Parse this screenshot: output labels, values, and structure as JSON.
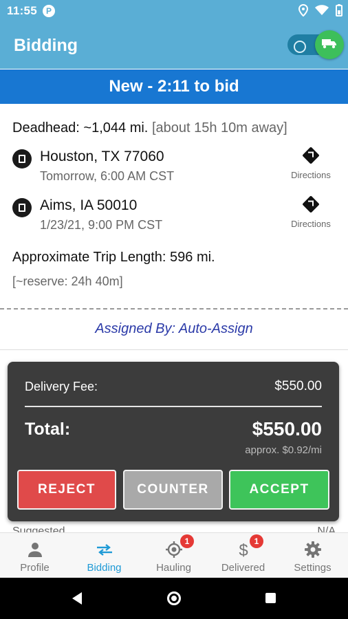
{
  "status_bar": {
    "time": "11:55",
    "app_icon": "P",
    "icons": [
      "location-icon",
      "wifi-icon",
      "battery-icon"
    ]
  },
  "app_bar": {
    "title": "Bidding",
    "toggle": {
      "left_icon": "no-entry-icon",
      "right_icon": "truck-icon",
      "state": "on",
      "on_color": "#3dbf5b"
    }
  },
  "banner": {
    "text": "New - 2:11 to bid",
    "color": "#1877d2"
  },
  "load": {
    "deadhead_label": "Deadhead: ~1,044 mi.",
    "deadhead_eta": "[about 15h 10m away]",
    "stops": [
      {
        "city": "Houston, TX 77060",
        "when": "Tomorrow, 6:00 AM CST",
        "directions_label": "Directions"
      },
      {
        "city": "Aims, IA 50010",
        "when": "1/23/21, 9:00 PM CST",
        "directions_label": "Directions"
      }
    ],
    "trip_length": "Approximate Trip Length: 596 mi.",
    "reserve": "[~reserve: 24h 40m]",
    "assigned_by": "Assigned By: Auto-Assign"
  },
  "price_card": {
    "delivery_fee_label": "Delivery Fee:",
    "delivery_fee_value": "$550.00",
    "total_label": "Total:",
    "total_value": "$550.00",
    "approx_rate": "approx. $0.92/mi",
    "buttons": {
      "reject": "REJECT",
      "counter": "COUNTER",
      "accept": "ACCEPT"
    }
  },
  "peek": {
    "left": "Suggested",
    "right": "N/A"
  },
  "bottom_nav": [
    {
      "label": "Profile",
      "icon": "person-icon",
      "badge": "",
      "active": false
    },
    {
      "label": "Bidding",
      "icon": "swap-arrows-icon",
      "badge": "",
      "active": true
    },
    {
      "label": "Hauling",
      "icon": "location-target-icon",
      "badge": "1",
      "active": false
    },
    {
      "label": "Delivered",
      "icon": "dollar-icon",
      "badge": "1",
      "active": false
    },
    {
      "label": "Settings",
      "icon": "gear-icon",
      "badge": "",
      "active": false
    }
  ],
  "colors": {
    "app_bar": "#5aaed5",
    "active_nav": "#1e9ad6",
    "reject": "#e04a4a",
    "counter": "#a9a9a9",
    "accept": "#3ec45a"
  }
}
